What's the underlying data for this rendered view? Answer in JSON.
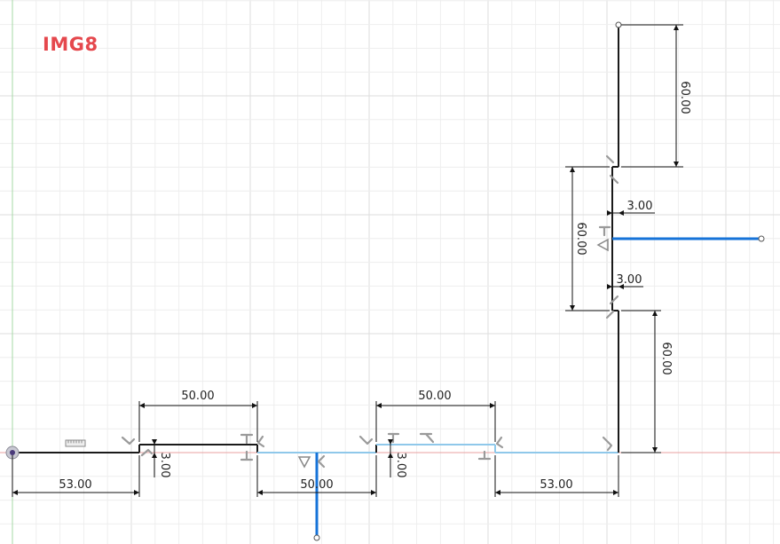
{
  "badge": {
    "text": "IMG8",
    "fill": "#e5484d",
    "stroke": "#ffffff"
  },
  "colors": {
    "grid_minor": "#eeeeee",
    "grid_major": "#dedede",
    "x_axis": "#e8a0a0",
    "y_axis": "#a6d8a6",
    "line": "#1a1a1a",
    "projected": "#8fc8ea",
    "selected": "#1673d8",
    "dimension": "#111111",
    "constraint": "#9a9a9a"
  },
  "dimensions": {
    "bottom_left": "53.00",
    "step_1": "3.00",
    "top_1": "50.00",
    "gap": "50.00",
    "top_2": "50.00",
    "step_2": "3.00",
    "bottom_right": "53.00",
    "vertical_low": "60.00",
    "step_3": "3.00",
    "vertical_mid": "60.00",
    "step_4": "3.00",
    "vertical_top": "60.00"
  }
}
